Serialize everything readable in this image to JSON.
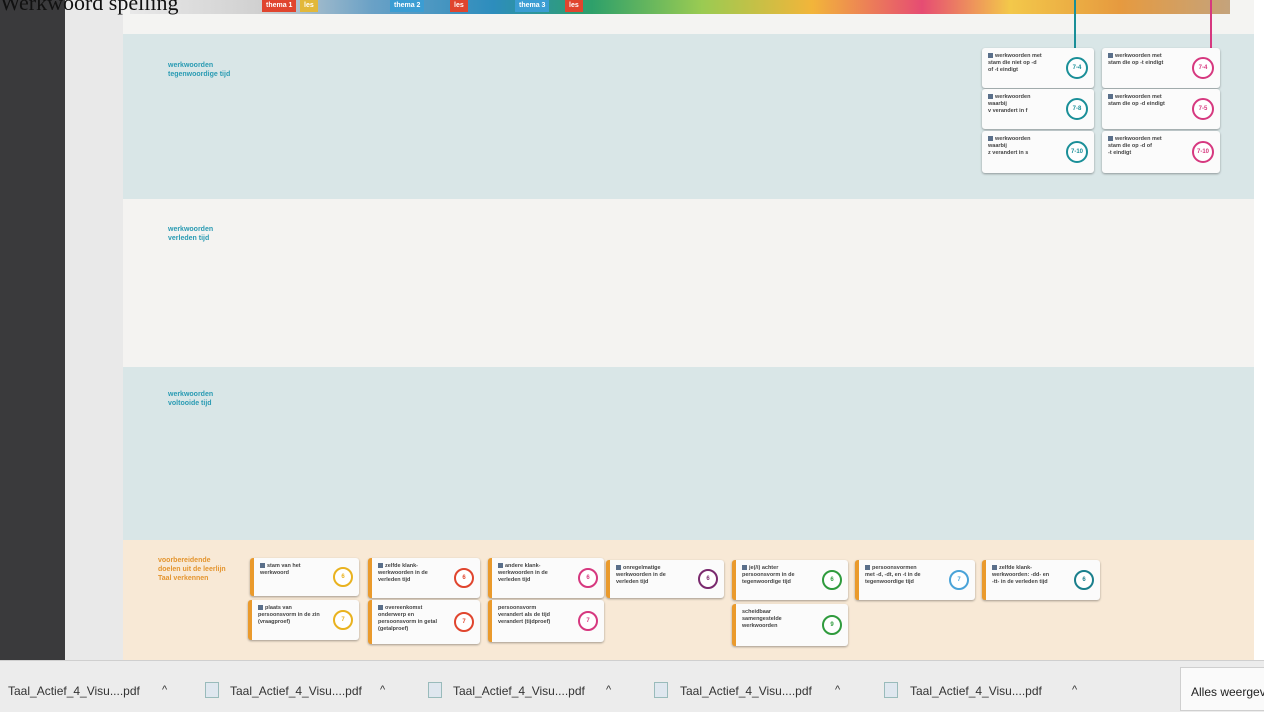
{
  "heading": "Werkwoord spelling",
  "banner": {
    "tags": [
      "thema 1",
      "les",
      "thema 2",
      "les",
      "thema 3",
      "les"
    ]
  },
  "bands": {
    "b1": [
      "werkwoorden",
      "tegenwoordige tijd"
    ],
    "b2": [
      "werkwoorden",
      "verleden tijd"
    ],
    "b3": [
      "werkwoorden",
      "voltooide tijd"
    ],
    "b4": [
      "voorbereidende",
      "doelen uit de leerlijn",
      "Taal verkennen"
    ]
  },
  "top_cards": {
    "teal": [
      {
        "text": [
          "werkwoorden met",
          "stam die niet op -d",
          "of -t eindigt"
        ],
        "num": "7-4"
      },
      {
        "text": [
          "werkwoorden",
          "waarbij",
          "v verandert in f"
        ],
        "num": "7-8"
      },
      {
        "text": [
          "werkwoorden",
          "waarbij",
          "z verandert in s"
        ],
        "num": "7-10"
      }
    ],
    "pink": [
      {
        "text": [
          "werkwoorden met",
          "stam die op -t eindigt"
        ],
        "num": "7-4"
      },
      {
        "text": [
          "werkwoorden met",
          "stam die op -d eindigt"
        ],
        "num": "7-5"
      },
      {
        "text": [
          "werkwoorden met",
          "stam die op -d of",
          "-t eindigt"
        ],
        "num": "7-10"
      }
    ]
  },
  "bottom_cards": [
    {
      "text": [
        "stam van het",
        "werkwoord"
      ],
      "num": "6",
      "color": "#e9b21f"
    },
    {
      "text": [
        "plaats van",
        "persoonsvorm in de zin",
        "(vraagproef)"
      ],
      "num": "7",
      "color": "#e9b21f"
    },
    {
      "text": [
        "zelfde klank-",
        "werkwoorden in de",
        "verleden tijd"
      ],
      "num": "6",
      "color": "#e0452e"
    },
    {
      "text": [
        "overeenkomst",
        "onderwerp en",
        "persoonsvorm in getal",
        "(getalproef)"
      ],
      "num": "7",
      "color": "#e0452e"
    },
    {
      "text": [
        "andere klank-",
        "werkwoorden in de",
        "verleden tijd"
      ],
      "num": "6",
      "color": "#d6387f"
    },
    {
      "text": [
        "persoonsvorm",
        "verandert als de tijd",
        "verandert (tijdproef)"
      ],
      "num": "7",
      "color": "#d6387f"
    },
    {
      "text": [
        "onregelmatige",
        "werkwoorden in de",
        "verleden tijd"
      ],
      "num": "6",
      "color": "#7a2a6e"
    },
    {
      "text": [
        "je(/i) achter",
        "persoonsvorm in de",
        "tegenwoordige tijd"
      ],
      "num": "6",
      "color": "#2f9b3d"
    },
    {
      "text": [
        "scheidbaar",
        "samengestelde",
        "werkwoorden"
      ],
      "num": "9",
      "color": "#2f9b3d"
    },
    {
      "text": [
        "persoonsvormen",
        "met -d, -dt, en -t in de",
        "tegenwoordige tijd"
      ],
      "num": "7",
      "color": "#4aa3d8"
    },
    {
      "text": [
        "zelfde klank-",
        "werkwoorden: -dd- en",
        "-tt- in de verleden tijd"
      ],
      "num": "6",
      "color": "#1a7f8c"
    }
  ],
  "downloads": [
    "Taal_Actief_4_Visu....pdf",
    "Taal_Actief_4_Visu....pdf",
    "Taal_Actief_4_Visu....pdf",
    "Taal_Actief_4_Visu....pdf",
    "Taal_Actief_4_Visu....pdf"
  ],
  "chevron": "^",
  "show_all": "Alles weergeven"
}
